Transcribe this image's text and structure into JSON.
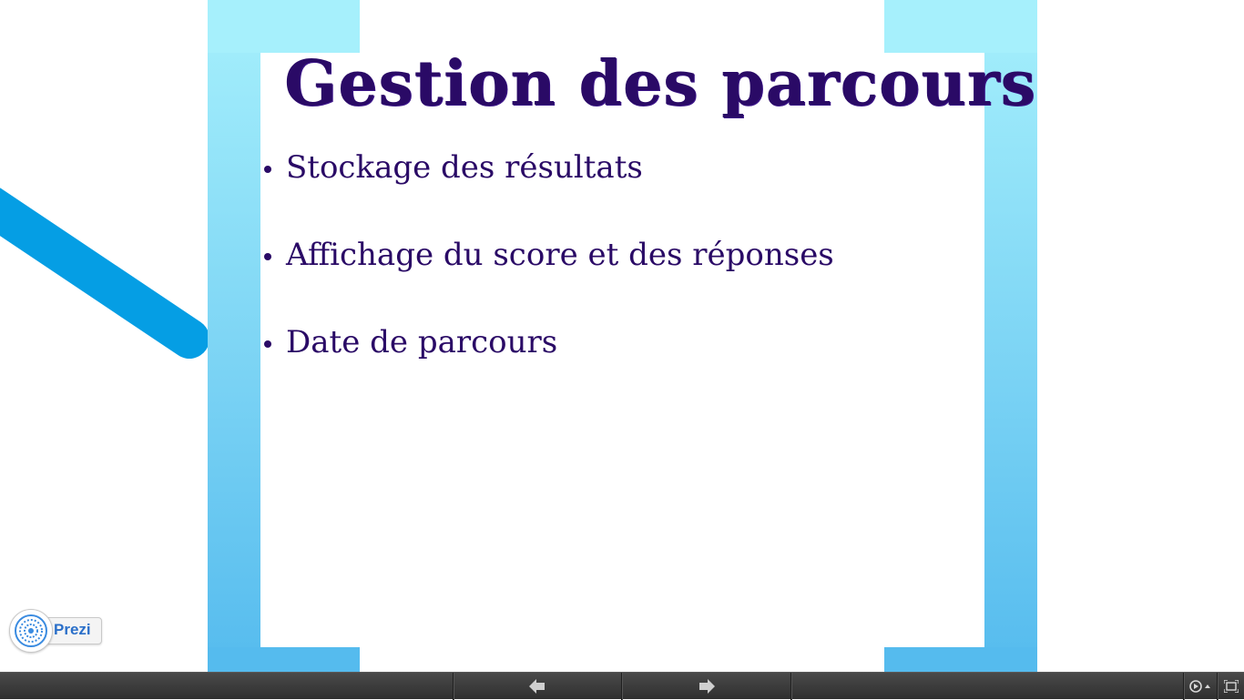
{
  "slide": {
    "title": "Gestion des parcours",
    "bullets": [
      "Stockage des résultats",
      "Affichage du score et des réponses",
      "Date de parcours"
    ]
  },
  "branding": {
    "logo_text": "Prezi"
  },
  "toolbar": {
    "prev_icon": "arrow-left-icon",
    "next_icon": "arrow-right-icon",
    "autoplay_icon": "autoplay-icon",
    "fullscreen_icon": "fullscreen-icon"
  },
  "colors": {
    "title": "#2a0a66",
    "frame_top": "#a6f0fc",
    "frame_bottom": "#55bbee",
    "connector": "#059ee4",
    "toolbar": "#3a3a3a"
  }
}
